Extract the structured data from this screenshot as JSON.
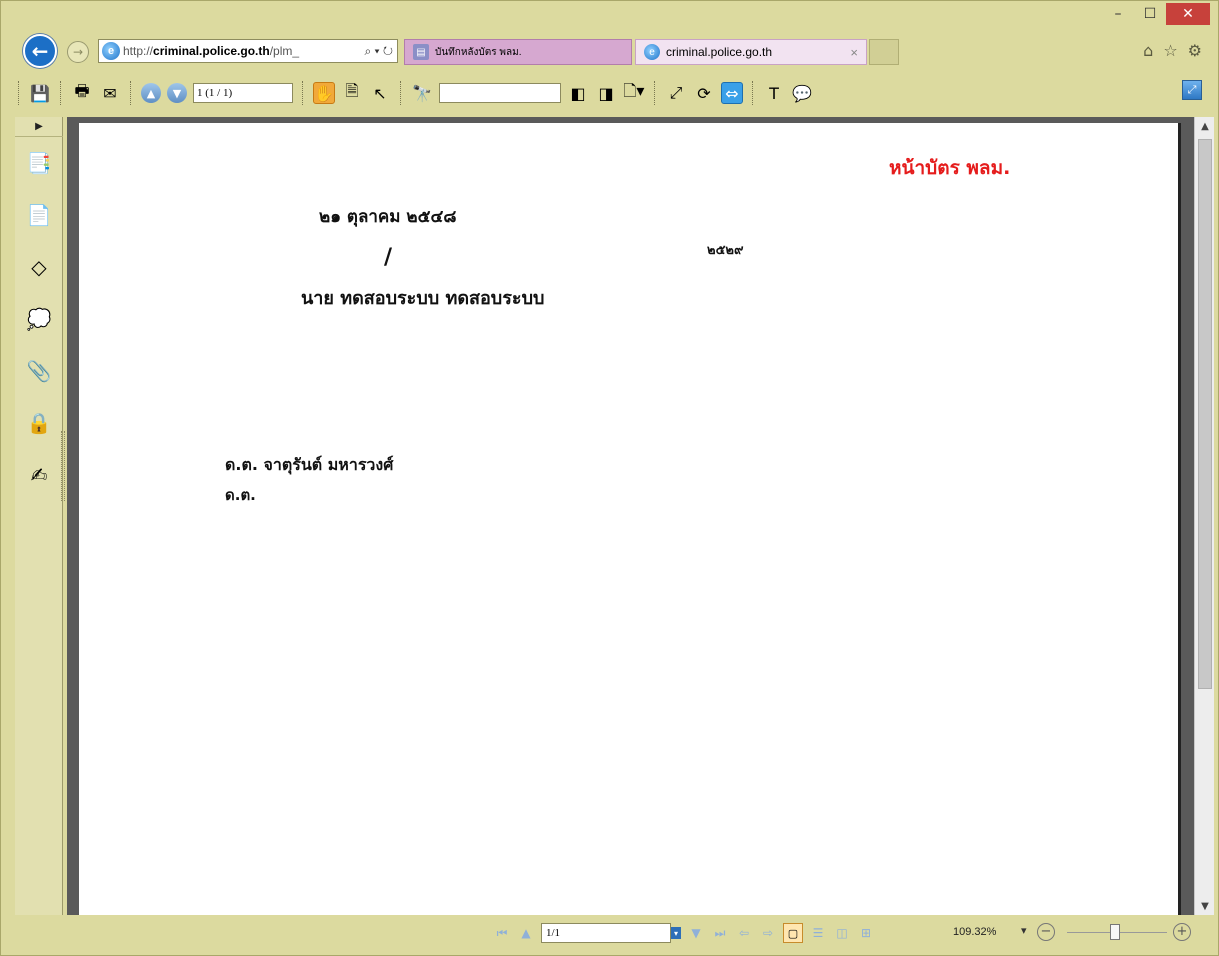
{
  "window": {
    "minimize": "–",
    "maximize": "☐",
    "close": "✕"
  },
  "browser": {
    "address_prefix": "http://",
    "address_domain": "criminal.police.go.th",
    "address_suffix": "/plm_",
    "address_actions": "⌕ ▾ ↻",
    "tabs": [
      {
        "label": "บันทึกหลังบัตร พลม.",
        "active": false
      },
      {
        "label": "criminal.police.go.th",
        "active": true,
        "close": "×"
      }
    ],
    "right_icons": {
      "home": "⌂",
      "favorites": "☆",
      "settings": "⚙"
    }
  },
  "toolbar": {
    "page_field": "1 (1 / 1)",
    "search_value": ""
  },
  "document": {
    "stamp": "หน้าบัตร พลม.",
    "date": "๒๑ ตุลาคม ๒๕๔๘",
    "number": "๒๕๒๙",
    "slash": "/",
    "name": "นาย ทดสอบระบบ  ทดสอบระบบ",
    "signer": "ด.ต. จาตุรันต์ มหารวงศ์",
    "signer_rank": "ด.ต."
  },
  "statusbar": {
    "page_value": "1/1",
    "zoom": "109.32%",
    "zoom_level_percent": 109.32
  },
  "colors": {
    "chrome": "#dcda9f",
    "stamp_red": "#e51c1c",
    "back_blue": "#1c6fc6"
  }
}
